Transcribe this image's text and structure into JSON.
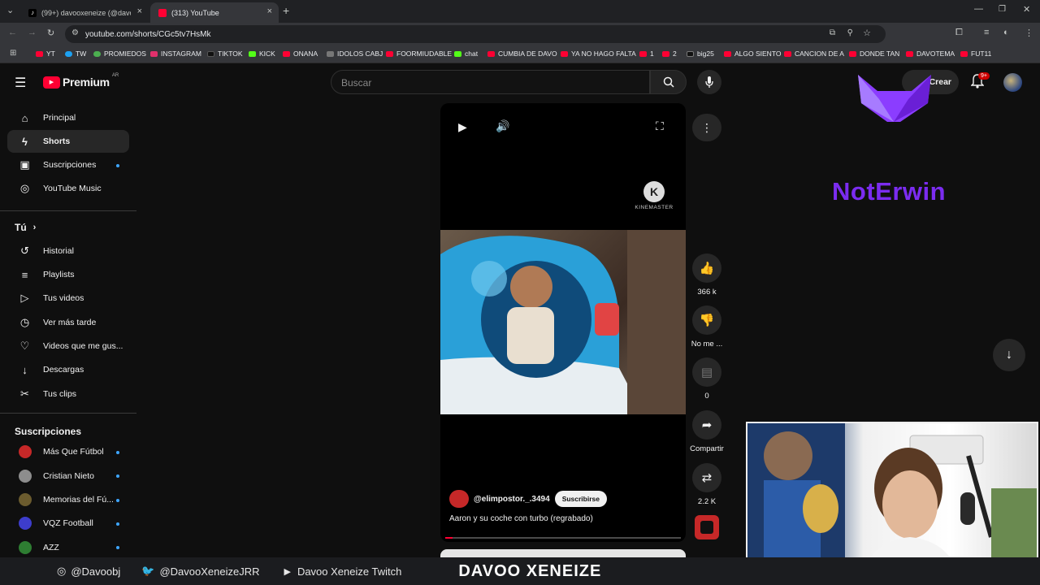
{
  "browser": {
    "tabs": [
      {
        "title": "(99+) davooxeneize (@davooxe",
        "active": false
      },
      {
        "title": "(313) YouTube",
        "active": true
      }
    ],
    "url": "youtube.com/shorts/CGc5tv7HsMk",
    "bookmarks": [
      "YT",
      "TW",
      "PROMIEDOS",
      "INSTAGRAM",
      "TIKTOK",
      "KICK",
      "ONANA",
      "IDOLOS CABJ",
      "FOORMIUDABLE",
      "chat",
      "CUMBIA DE DAVO",
      "YA NO HAGO FALTA",
      "1",
      "2",
      "big25",
      "ALGO SIENTO",
      "CANCION DE A",
      "DONDE TAN",
      "DAVOTEMA",
      "FUT11"
    ]
  },
  "header": {
    "logo": "Premium",
    "country": "AR",
    "search_placeholder": "Buscar",
    "create_label": "Crear",
    "notif_badge": "9+"
  },
  "sidebar": {
    "main": [
      {
        "label": "Principal",
        "icon": "home-icon"
      },
      {
        "label": "Shorts",
        "icon": "shorts-icon"
      },
      {
        "label": "Suscripciones",
        "icon": "subscriptions-icon"
      },
      {
        "label": "YouTube Music",
        "icon": "music-icon"
      }
    ],
    "you_heading": "Tú",
    "you": [
      {
        "label": "Historial",
        "icon": "history-icon"
      },
      {
        "label": "Playlists",
        "icon": "playlist-icon"
      },
      {
        "label": "Tus videos",
        "icon": "video-icon"
      },
      {
        "label": "Ver más tarde",
        "icon": "clock-icon"
      },
      {
        "label": "Videos que me gus...",
        "icon": "like-icon"
      },
      {
        "label": "Descargas",
        "icon": "download-icon"
      },
      {
        "label": "Tus clips",
        "icon": "scissors-icon"
      }
    ],
    "subs_heading": "Suscripciones",
    "subs": [
      {
        "label": "Más Que Fútbol",
        "color": "#c62828"
      },
      {
        "label": "Cristian Nieto",
        "color": "#8d8d8d"
      },
      {
        "label": "Memorias del Fú...",
        "color": "#6b5b2e"
      },
      {
        "label": "VQZ Football",
        "color": "#3d3dcc"
      },
      {
        "label": "AZZ",
        "color": "#2e7d32"
      }
    ]
  },
  "short": {
    "watermark": "KINEMASTER",
    "channel": "@elimpostor._.3494",
    "subscribe_label": "Suscribirse",
    "title": "Aaron y su coche con turbo (regrabado)",
    "progress": 0.03,
    "actions": {
      "likes": "366 k",
      "dislike": "No me ...",
      "comments": "0",
      "share": "Compartir",
      "remix": "2.2 K"
    }
  },
  "overlay": {
    "brand": "NotErwin",
    "instagram": "@Davoobj",
    "twitter": "@DavooXeneizeJRR",
    "twitch": "Davoo Xeneize Twitch",
    "logo": "DAVOO XENEIZE"
  },
  "colors": {
    "accent_red": "#ff0033",
    "brand_purple": "#7b2cf0",
    "link_blue": "#3ea6ff"
  }
}
